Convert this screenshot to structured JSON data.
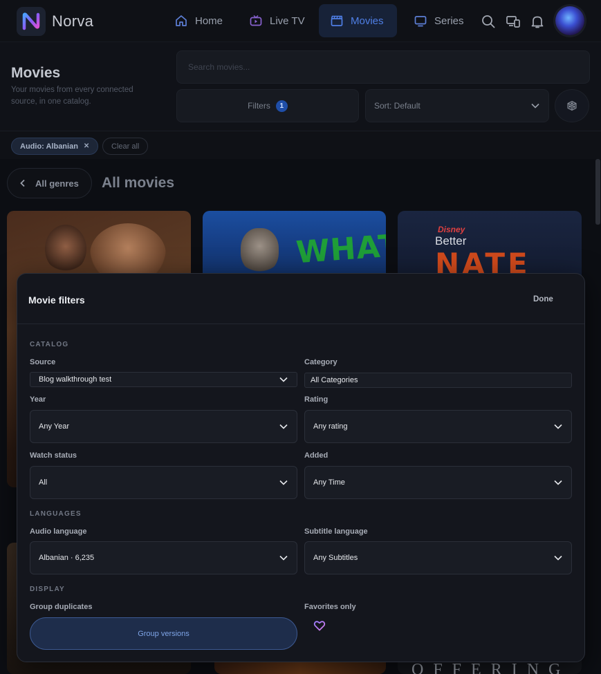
{
  "nav": {
    "brand": "Norva",
    "items": [
      {
        "label": "Home",
        "icon": "home-icon"
      },
      {
        "label": "Live TV",
        "icon": "tv-icon"
      },
      {
        "label": "Movies",
        "icon": "clapperboard-icon",
        "active": true
      },
      {
        "label": "Series",
        "icon": "monitor-icon"
      }
    ],
    "right_icons": [
      "search-icon",
      "devices-icon",
      "bell-icon"
    ]
  },
  "header": {
    "title": "Movies",
    "subtitle": "Your movies from every connected source, in one catalog.",
    "search_placeholder": "Search movies...",
    "filters_label": "Filters",
    "filters_count": "1",
    "sort_label": "Sort: Default"
  },
  "chips": {
    "active_label": "Audio: Albanian",
    "remove_symbol": "✕",
    "clear_label": "Clear all"
  },
  "genre": {
    "back_label": "All genres",
    "heading": "All movies"
  },
  "posters": {
    "p2_text": "WHAT",
    "p3_brand": "Disney",
    "p3_line1": "Better",
    "p3_line2": "NATE",
    "p5_text": "OFFERING"
  },
  "modal": {
    "title": "Movie filters",
    "done_label": "Done",
    "sections": {
      "catalog": "CATALOG",
      "languages": "LANGUAGES",
      "display": "DISPLAY"
    },
    "fields": {
      "source": {
        "label": "Source",
        "value": "Blog walkthrough test"
      },
      "category": {
        "label": "Category",
        "value": "All Categories"
      },
      "year": {
        "label": "Year",
        "value": "Any Year"
      },
      "rating": {
        "label": "Rating",
        "value": "Any rating"
      },
      "watch_status": {
        "label": "Watch status",
        "value": "All"
      },
      "added": {
        "label": "Added",
        "value": "Any Time"
      },
      "audio_language": {
        "label": "Audio language",
        "value": "Albanian · 6,235"
      },
      "subtitle_language": {
        "label": "Subtitle language",
        "value": "Any Subtitles"
      },
      "group_duplicates": {
        "label": "Group duplicates",
        "button": "Group versions"
      },
      "favorites_only": {
        "label": "Favorites only"
      }
    }
  },
  "colors": {
    "accent": "#4f7fe6",
    "background": "#0c0e13",
    "modal_bg": "#14161d",
    "badge": "#1f4ea8"
  }
}
